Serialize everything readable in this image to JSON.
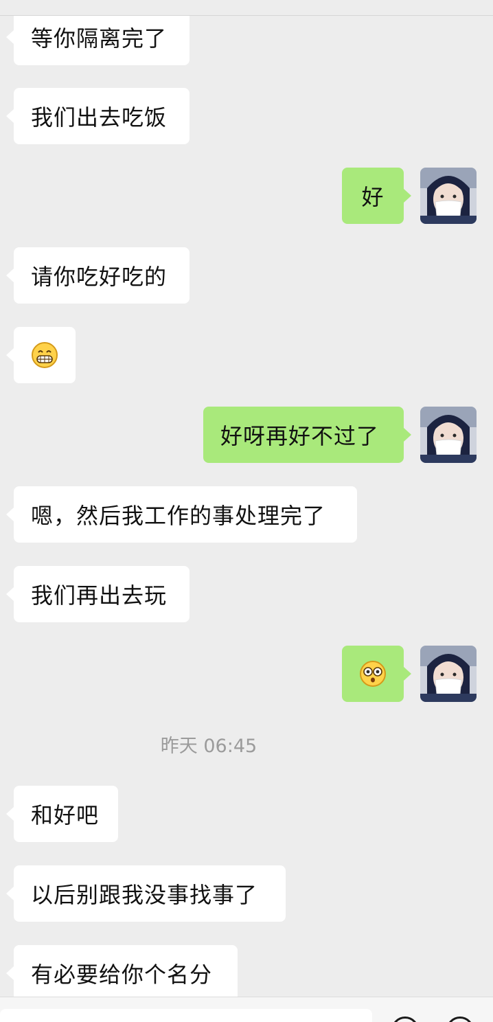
{
  "messages": [
    {
      "text": "等你隔离完了"
    },
    {
      "text": "我们出去吃饭"
    },
    {
      "text": "好"
    },
    {
      "text": "请你吃好吃的"
    },
    {
      "emoji": "grin-emoji"
    },
    {
      "text": "好呀再好不过了"
    },
    {
      "text": "嗯，然后我工作的事处理完了"
    },
    {
      "text": "我们再出去玩"
    },
    {
      "emoji": "dizzy-eyes-emoji"
    },
    {
      "text": "和好吧"
    },
    {
      "text": "以后别跟我没事找事了"
    },
    {
      "text": "有必要给你个名分"
    }
  ],
  "timestamp": "昨天 06:45",
  "colors": {
    "background": "#ededed",
    "incoming_bubble": "#ffffff",
    "outgoing_bubble": "#a9e97b",
    "timestamp_text": "#9b9b9b"
  },
  "icons": [
    "voice-toggle-icon",
    "emoji-button-icon",
    "more-plus-icon"
  ]
}
